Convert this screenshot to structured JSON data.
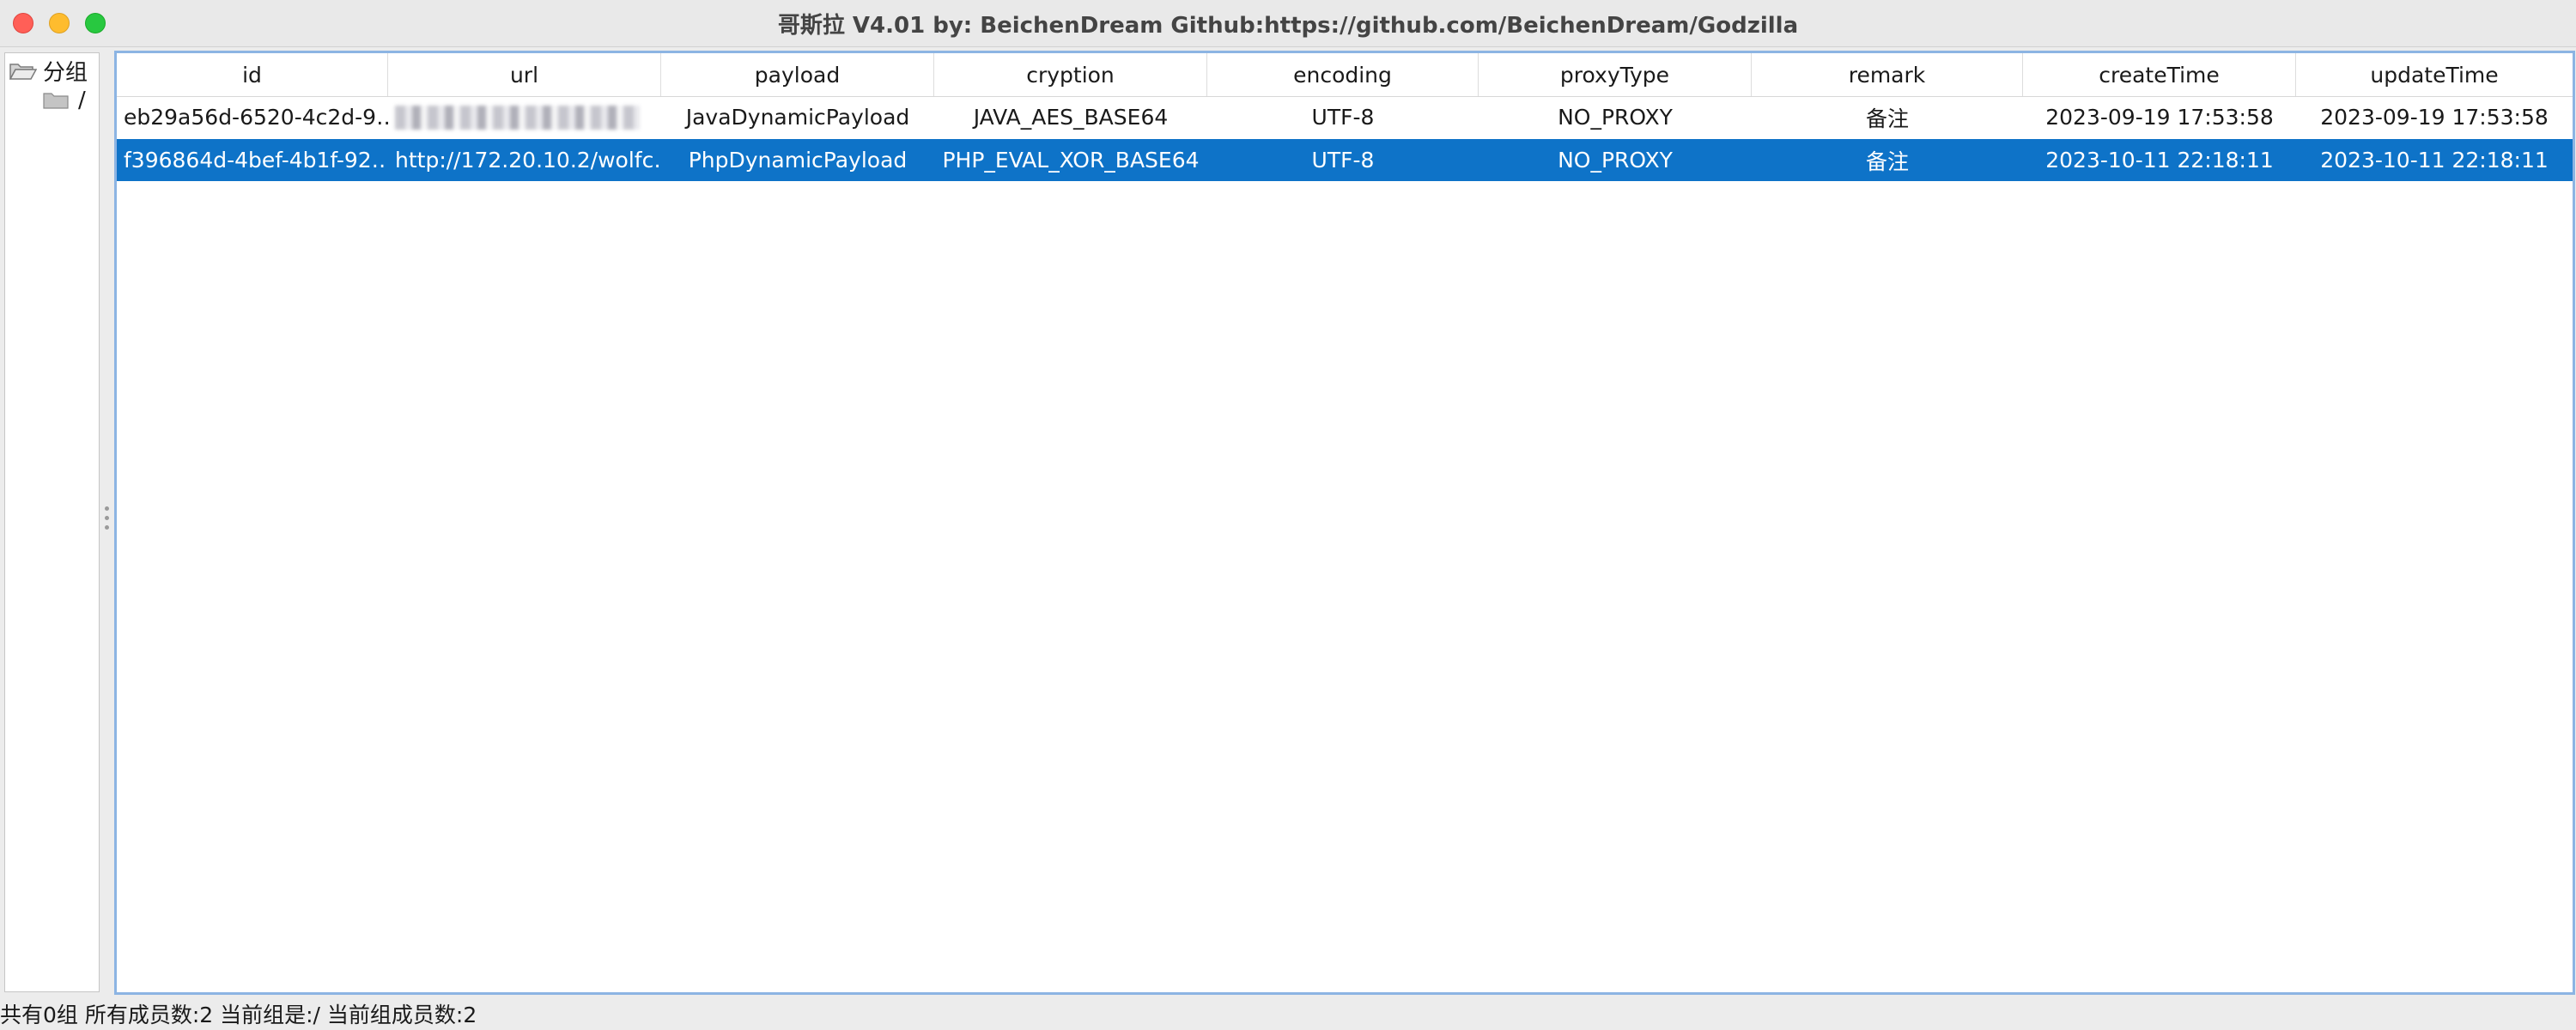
{
  "window": {
    "title": "哥斯拉   V4.01 by: BeichenDream Github:https://github.com/BeichenDream/Godzilla"
  },
  "sidebar": {
    "root_label": "分组",
    "root_icon": "folder-open-icon",
    "child_label": "/",
    "child_icon": "folder-icon"
  },
  "table": {
    "columns": [
      "id",
      "url",
      "payload",
      "cryption",
      "encoding",
      "proxyType",
      "remark",
      "createTime",
      "updateTime"
    ],
    "rows": [
      {
        "id": "eb29a56d-6520-4c2d-9…",
        "url": "",
        "url_redacted": true,
        "payload": "JavaDynamicPayload",
        "cryption": "JAVA_AES_BASE64",
        "encoding": "UTF-8",
        "proxyType": "NO_PROXY",
        "remark": "备注",
        "createTime": "2023-09-19 17:53:58",
        "updateTime": "2023-09-19 17:53:58",
        "selected": false
      },
      {
        "id": "f396864d-4bef-4b1f-92…",
        "url": "http://172.20.10.2/wolfc…",
        "url_redacted": false,
        "payload": "PhpDynamicPayload",
        "cryption": "PHP_EVAL_XOR_BASE64",
        "encoding": "UTF-8",
        "proxyType": "NO_PROXY",
        "remark": "备注",
        "createTime": "2023-10-11 22:18:11",
        "updateTime": "2023-10-11 22:18:11",
        "selected": true
      }
    ]
  },
  "statusbar": {
    "text": "共有0组 所有成员数:2 当前组是:/ 当前组成员数:2"
  },
  "colors": {
    "selection": "#0e73c8",
    "table_border": "#8cb4e3",
    "close": "#ff5f57",
    "minimize": "#febc2e",
    "maximize": "#28c840"
  }
}
